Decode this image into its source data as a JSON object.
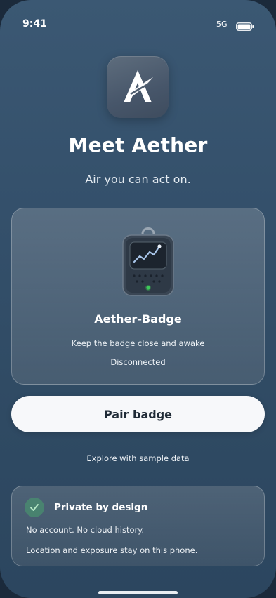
{
  "status_bar": {
    "time": "9:41",
    "network": "5G",
    "battery_icon": "battery-full-icon"
  },
  "app": {
    "icon": "aether-logo-icon",
    "title": "Meet Aether",
    "subtitle": "Air you can act on."
  },
  "device_card": {
    "illustration": "badge-device-icon",
    "name": "Aether-Badge",
    "hint": "Keep the badge close and awake",
    "status": "Disconnected",
    "led_color": "#3ec95a"
  },
  "actions": {
    "pair_label": "Pair badge",
    "sample_label": "Explore with sample data"
  },
  "privacy": {
    "icon": "check-icon",
    "title": "Private by design",
    "line1": "No account. No cloud history.",
    "line2": "Location and exposure stay on this phone."
  },
  "colors": {
    "background": "#34506b",
    "button": "#f7f8fa",
    "accent_green": "#48a06e"
  }
}
